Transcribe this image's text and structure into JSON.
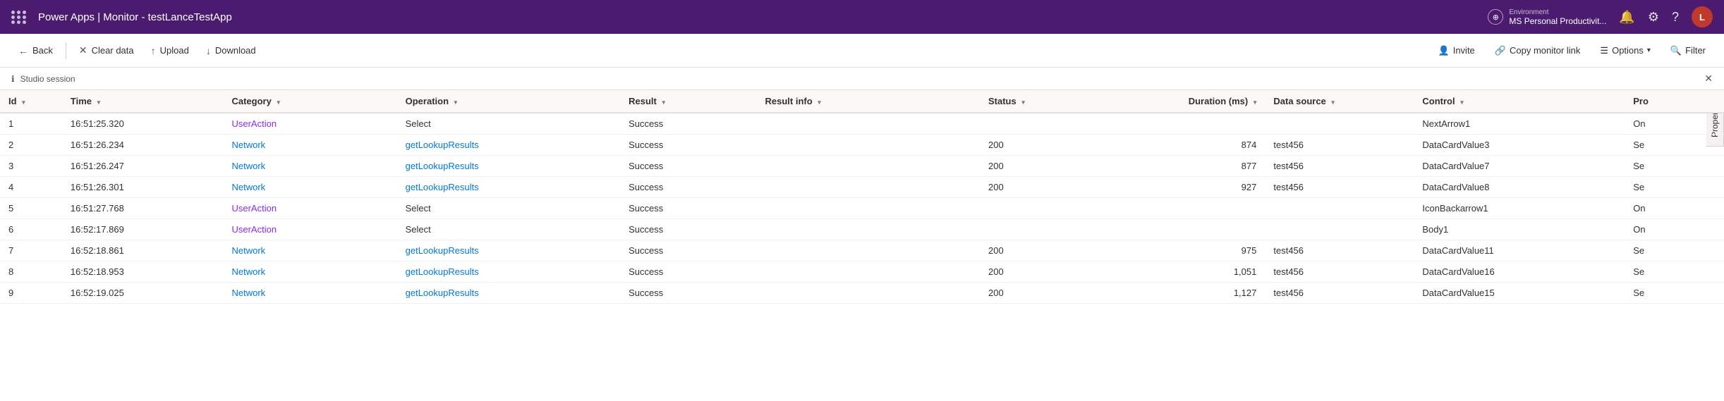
{
  "topbar": {
    "app_dots": "waffle-icon",
    "title": "Power Apps | Monitor - testLanceTestApp",
    "env_label": "Environment",
    "env_name": "MS Personal Productivit...",
    "avatar_initials": "L"
  },
  "toolbar": {
    "back_label": "Back",
    "clear_label": "Clear data",
    "upload_label": "Upload",
    "download_label": "Download",
    "invite_label": "Invite",
    "copy_monitor_label": "Copy monitor link",
    "options_label": "Options",
    "filter_label": "Filter"
  },
  "session": {
    "label": "Studio session",
    "properties_tab": "Properties"
  },
  "table": {
    "columns": [
      {
        "key": "id",
        "label": "Id",
        "sortable": true
      },
      {
        "key": "time",
        "label": "Time",
        "sortable": true
      },
      {
        "key": "category",
        "label": "Category",
        "sortable": true
      },
      {
        "key": "operation",
        "label": "Operation",
        "sortable": true
      },
      {
        "key": "result",
        "label": "Result",
        "sortable": true
      },
      {
        "key": "result_info",
        "label": "Result info",
        "sortable": true
      },
      {
        "key": "status",
        "label": "Status",
        "sortable": true
      },
      {
        "key": "duration",
        "label": "Duration (ms)",
        "sortable": true
      },
      {
        "key": "datasource",
        "label": "Data source",
        "sortable": true
      },
      {
        "key": "control",
        "label": "Control",
        "sortable": true
      },
      {
        "key": "pro",
        "label": "Pro",
        "sortable": false
      }
    ],
    "rows": [
      {
        "id": "1",
        "time": "16:51:25.320",
        "category": "UserAction",
        "operation": "Select",
        "result": "Success",
        "result_info": "",
        "status": "",
        "duration": "",
        "datasource": "",
        "control": "NextArrow1",
        "pro": "On"
      },
      {
        "id": "2",
        "time": "16:51:26.234",
        "category": "Network",
        "operation": "getLookupResults",
        "result": "Success",
        "result_info": "",
        "status": "200",
        "duration": "874",
        "datasource": "test456",
        "control": "DataCardValue3",
        "pro": "Se"
      },
      {
        "id": "3",
        "time": "16:51:26.247",
        "category": "Network",
        "operation": "getLookupResults",
        "result": "Success",
        "result_info": "",
        "status": "200",
        "duration": "877",
        "datasource": "test456",
        "control": "DataCardValue7",
        "pro": "Se"
      },
      {
        "id": "4",
        "time": "16:51:26.301",
        "category": "Network",
        "operation": "getLookupResults",
        "result": "Success",
        "result_info": "",
        "status": "200",
        "duration": "927",
        "datasource": "test456",
        "control": "DataCardValue8",
        "pro": "Se"
      },
      {
        "id": "5",
        "time": "16:51:27.768",
        "category": "UserAction",
        "operation": "Select",
        "result": "Success",
        "result_info": "",
        "status": "",
        "duration": "",
        "datasource": "",
        "control": "IconBackarrow1",
        "pro": "On"
      },
      {
        "id": "6",
        "time": "16:52:17.869",
        "category": "UserAction",
        "operation": "Select",
        "result": "Success",
        "result_info": "",
        "status": "",
        "duration": "",
        "datasource": "",
        "control": "Body1",
        "pro": "On"
      },
      {
        "id": "7",
        "time": "16:52:18.861",
        "category": "Network",
        "operation": "getLookupResults",
        "result": "Success",
        "result_info": "",
        "status": "200",
        "duration": "975",
        "datasource": "test456",
        "control": "DataCardValue11",
        "pro": "Se"
      },
      {
        "id": "8",
        "time": "16:52:18.953",
        "category": "Network",
        "operation": "getLookupResults",
        "result": "Success",
        "result_info": "",
        "status": "200",
        "duration": "1,051",
        "datasource": "test456",
        "control": "DataCardValue16",
        "pro": "Se"
      },
      {
        "id": "9",
        "time": "16:52:19.025",
        "category": "Network",
        "operation": "getLookupResults",
        "result": "Success",
        "result_info": "",
        "status": "200",
        "duration": "1,127",
        "datasource": "test456",
        "control": "DataCardValue15",
        "pro": "Se"
      }
    ]
  }
}
